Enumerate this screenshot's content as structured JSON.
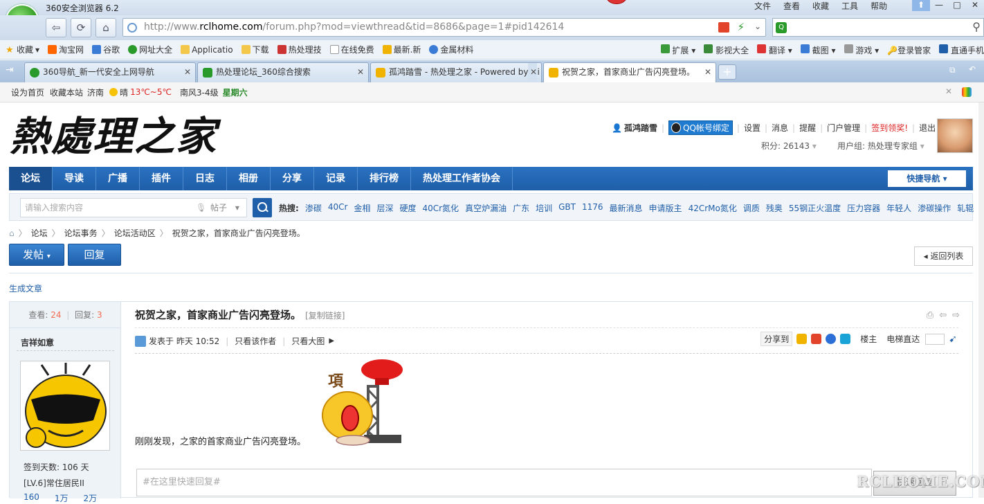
{
  "browser": {
    "title": "360安全浏览器 6.2",
    "menu": [
      "文件",
      "查看",
      "收藏",
      "工具",
      "帮助"
    ],
    "url_prefix": "http://www.",
    "url_domain": "rclhome.com",
    "url_suffix": "/forum.php?mod=viewthread&tid=8686&page=1#pid142614",
    "bookmarks": [
      "收藏",
      "淘宝网",
      "谷歌",
      "网址大全",
      "Applicatio",
      "下载",
      "热处理技",
      "在线免费",
      "最新.新",
      "金属材料"
    ],
    "bookmarks_right": [
      "扩展",
      "影视大全",
      "翻译",
      "截图",
      "游戏",
      "登录管家",
      "直通手机"
    ],
    "tabs": [
      "360导航_新一代安全上网导航",
      "热处理论坛_360综合搜索",
      "孤鸿踏雪 - 热处理之家 - Powered by Di",
      "祝贺之家，首家商业广告闪亮登场。"
    ],
    "infobar": {
      "set_home": "设为首页",
      "bookmark_site": "收藏本站",
      "city": "济南",
      "weather": "晴",
      "temp": "13℃~5℃",
      "wind": "南风3-4级",
      "weekday": "星期六"
    }
  },
  "site": {
    "logo_text": "熱處理之家",
    "user": {
      "name": "孤鸿踏雪",
      "qq_bind": "QQ帐号绑定",
      "links": [
        "设置",
        "消息",
        "提醒",
        "门户管理"
      ],
      "checkin": "签到领奖!",
      "logout": "退出",
      "score": "积分: 26143",
      "group": "用户组: 热处理专家组"
    },
    "nav": [
      "论坛",
      "导读",
      "广播",
      "插件",
      "日志",
      "相册",
      "分享",
      "记录",
      "排行榜",
      "热处理工作者协会"
    ],
    "quick_nav": "快捷导航",
    "search": {
      "placeholder": "请输入搜索内容",
      "type": "帖子",
      "hot_label": "热搜:",
      "hot": [
        "渗碳",
        "40Cr",
        "金相",
        "层深",
        "硬度",
        "40Cr氮化",
        "真空炉漏油",
        "广东",
        "培训",
        "GBT",
        "1176",
        "最新消息",
        "申请版主",
        "42CrMo氮化",
        "调质",
        "残奥",
        "55钢正火温度",
        "压力容器",
        "年轻人",
        "渗碳操作",
        "轧辊"
      ]
    },
    "breadcrumb": [
      "论坛",
      "论坛事务",
      "论坛活动区",
      "祝贺之家，首家商业广告闪亮登场。"
    ],
    "buttons": {
      "post": "发帖",
      "reply": "回复",
      "back_list": "返回列表",
      "gen_article": "生成文章"
    }
  },
  "post": {
    "views_label": "查看:",
    "views": "24",
    "replies_label": "回复:",
    "replies": "3",
    "title": "祝贺之家，首家商业广告闪亮登场。",
    "copy_link": "[复制链接]",
    "author": "吉祥如意",
    "posted": "发表于 昨天 10:52",
    "only_author": "只看该作者",
    "big_image": "只看大图",
    "share_label": "分享到",
    "floor": "楼主",
    "elevator": "电梯直达",
    "sign_days": "签到天数: 106 天",
    "level": "[LV.6]常住居民II",
    "stats": [
      "160",
      "1万",
      "2万"
    ],
    "body": "刚刚发现，之家的首家商业广告闪亮登场。",
    "quick_reply_placeholder": "#在这里快速回复#",
    "quick_reply_btn": "快速回复"
  },
  "watermark": "RCLHOME.COM"
}
